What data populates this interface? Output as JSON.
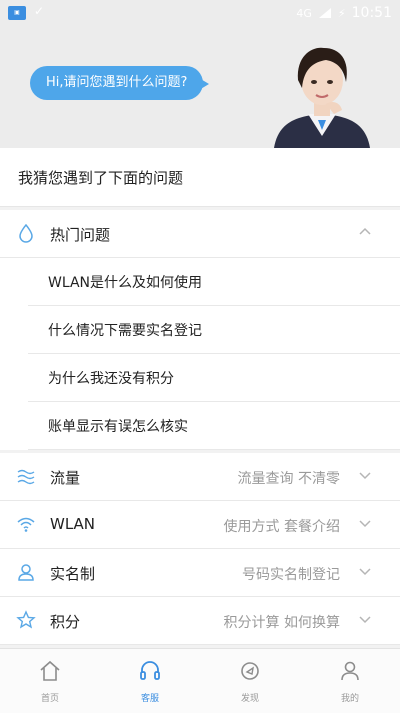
{
  "status_bar": {
    "app_icon": "app-icon",
    "network": "4G",
    "battery": "⚡",
    "time": "10:51"
  },
  "hero": {
    "bubble": "Hi,请问您遇到什么问题?"
  },
  "guess_title": "我猜您遇到了下面的问题",
  "hot": {
    "title": "热门问题",
    "icon": "drop-icon",
    "items": [
      "WLAN是什么及如何使用",
      "什么情况下需要实名登记",
      "为什么我还没有积分",
      "账单显示有误怎么核实"
    ]
  },
  "categories": [
    {
      "title": "流量",
      "desc": "流量查询 不清零",
      "icon": "waves-icon"
    },
    {
      "title": "WLAN",
      "desc": "使用方式 套餐介绍",
      "icon": "wifi-icon"
    },
    {
      "title": "实名制",
      "desc": "号码实名制登记",
      "icon": "person-icon"
    },
    {
      "title": "积分",
      "desc": "积分计算 如何换算",
      "icon": "star-icon"
    }
  ],
  "tabs": [
    {
      "label": "首页",
      "icon": "home-icon",
      "active": false
    },
    {
      "label": "客服",
      "icon": "headset-icon",
      "active": true
    },
    {
      "label": "发现",
      "icon": "discover-icon",
      "active": false
    },
    {
      "label": "我的",
      "icon": "profile-icon",
      "active": false
    }
  ],
  "colors": {
    "accent": "#3b8ee0",
    "bubble": "#4ea6ea",
    "icon": "#5aa8e6"
  }
}
